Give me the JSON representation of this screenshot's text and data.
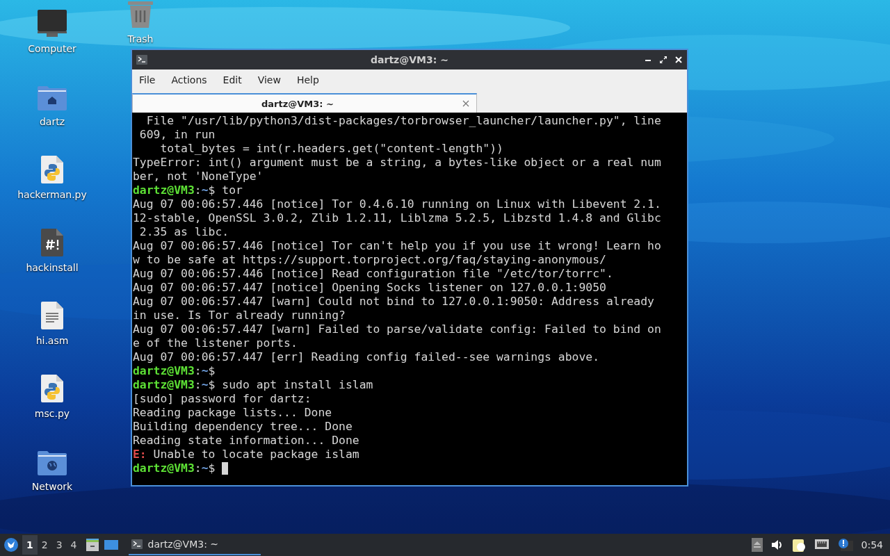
{
  "desktop": {
    "icons": [
      {
        "label": "Computer",
        "kind": "computer"
      },
      {
        "label": "Trash",
        "kind": "trash"
      },
      {
        "label": "dartz",
        "kind": "home"
      },
      {
        "label": "hackerman.py",
        "kind": "python"
      },
      {
        "label": "hackinstall",
        "kind": "script"
      },
      {
        "label": "hi.asm",
        "kind": "text"
      },
      {
        "label": "msc.py",
        "kind": "python"
      },
      {
        "label": "Network",
        "kind": "network"
      }
    ]
  },
  "window": {
    "title": "dartz@VM3: ~",
    "menu": [
      "File",
      "Actions",
      "Edit",
      "View",
      "Help"
    ],
    "tabs": [
      {
        "label": "dartz@VM3: ~",
        "selected": true
      }
    ],
    "terminal": {
      "lines": [
        {
          "kind": "output",
          "text": "  File \"/usr/lib/python3/dist-packages/torbrowser_launcher/launcher.py\", line"
        },
        {
          "kind": "output",
          "text": " 609, in run"
        },
        {
          "kind": "output",
          "text": "    total_bytes = int(r.headers.get(\"content-length\"))"
        },
        {
          "kind": "output",
          "text": "TypeError: int() argument must be a string, a bytes-like object or a real num"
        },
        {
          "kind": "output",
          "text": "ber, not 'NoneType'"
        },
        {
          "kind": "prompt",
          "user": "dartz@VM3",
          "sep": ":",
          "path": "~",
          "command": "$ tor"
        },
        {
          "kind": "output",
          "text": "Aug 07 00:06:57.446 [notice] Tor 0.4.6.10 running on Linux with Libevent 2.1."
        },
        {
          "kind": "output",
          "text": "12-stable, OpenSSL 3.0.2, Zlib 1.2.11, Liblzma 5.2.5, Libzstd 1.4.8 and Glibc"
        },
        {
          "kind": "output",
          "text": " 2.35 as libc."
        },
        {
          "kind": "output",
          "text": "Aug 07 00:06:57.446 [notice] Tor can't help you if you use it wrong! Learn ho"
        },
        {
          "kind": "output",
          "text": "w to be safe at https://support.torproject.org/faq/staying-anonymous/"
        },
        {
          "kind": "output",
          "text": "Aug 07 00:06:57.446 [notice] Read configuration file \"/etc/tor/torrc\"."
        },
        {
          "kind": "output",
          "text": "Aug 07 00:06:57.447 [notice] Opening Socks listener on 127.0.0.1:9050"
        },
        {
          "kind": "output",
          "text": "Aug 07 00:06:57.447 [warn] Could not bind to 127.0.0.1:9050: Address already"
        },
        {
          "kind": "output",
          "text": "in use. Is Tor already running?"
        },
        {
          "kind": "output",
          "text": "Aug 07 00:06:57.447 [warn] Failed to parse/validate config: Failed to bind on"
        },
        {
          "kind": "output",
          "text": "e of the listener ports."
        },
        {
          "kind": "output",
          "text": "Aug 07 00:06:57.447 [err] Reading config failed--see warnings above."
        },
        {
          "kind": "prompt",
          "user": "dartz@VM3",
          "sep": ":",
          "path": "~",
          "command": "$"
        },
        {
          "kind": "prompt",
          "user": "dartz@VM3",
          "sep": ":",
          "path": "~",
          "command": "$ sudo apt install islam"
        },
        {
          "kind": "output",
          "text": "[sudo] password for dartz:"
        },
        {
          "kind": "output",
          "text": "Reading package lists... Done"
        },
        {
          "kind": "output",
          "text": "Building dependency tree... Done"
        },
        {
          "kind": "output",
          "text": "Reading state information... Done"
        },
        {
          "kind": "error",
          "tag": "E:",
          "text": "Unable to locate package islam"
        },
        {
          "kind": "prompt",
          "user": "dartz@VM3",
          "sep": ":",
          "path": "~",
          "command": "$",
          "cursor": true
        }
      ]
    }
  },
  "taskbar": {
    "workspaces": [
      {
        "label": "1",
        "selected": true
      },
      {
        "label": "2",
        "selected": false
      },
      {
        "label": "3",
        "selected": false
      },
      {
        "label": "4",
        "selected": false
      }
    ],
    "tasks": [
      {
        "label": "dartz@VM3: ~",
        "selected": true
      }
    ],
    "clock": "0:54"
  }
}
